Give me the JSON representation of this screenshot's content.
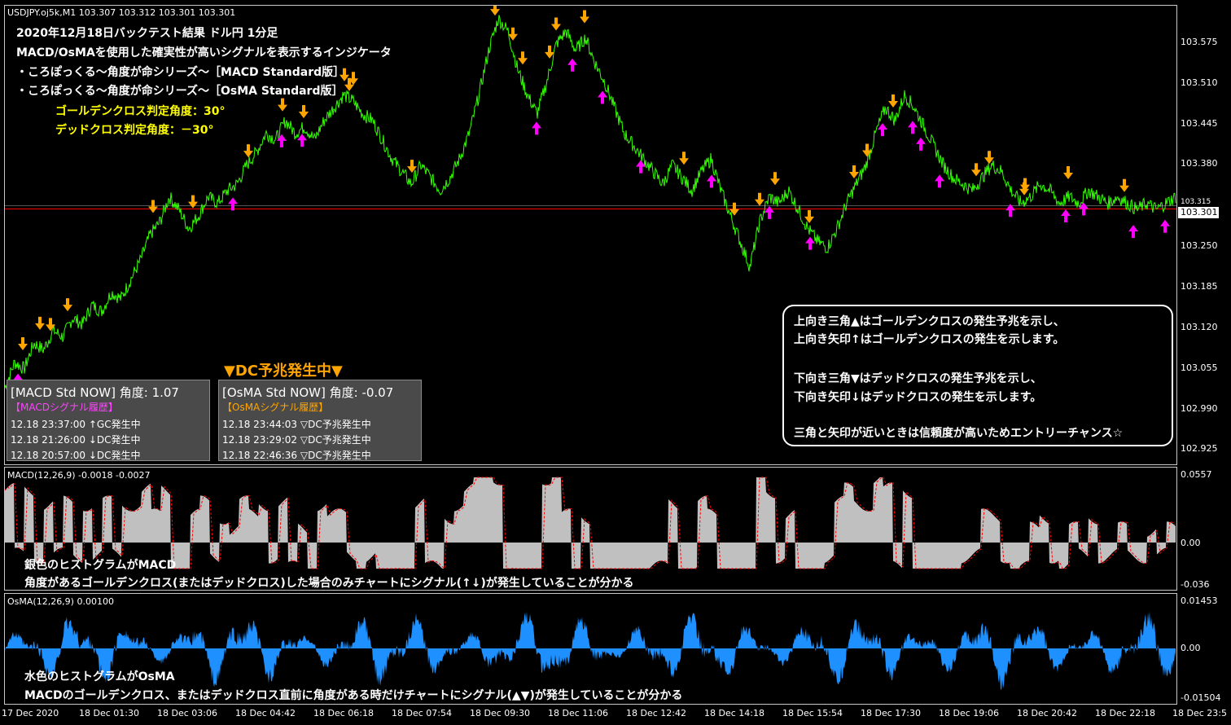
{
  "header": {
    "symbol_line": "USDJPY.oj5k,M1  103.307 103.312 103.301 103.301",
    "lines": [
      "2020年12月18日バックテスト結果 ドル円 1分足",
      "MACD/OsMAを使用した確実性が高いシグナルを表示するインジケータ",
      "・ころぽっくる～角度が命シリーズ～［MACD Standard版］",
      "・ころぽっくる～角度が命シリーズ～［OsMA Standard版］"
    ],
    "gc_angle": "ゴールデンクロス判定角度：30°",
    "dc_angle": "デッドクロス判定角度：－30°"
  },
  "price_axis": {
    "labels": [
      "103.575",
      "103.510",
      "103.445",
      "103.380",
      "103.315",
      "103.301",
      "103.250",
      "103.185",
      "103.120",
      "103.055",
      "102.990",
      "102.925"
    ]
  },
  "macd": {
    "title": "MACD(12,26,9) -0.0018 -0.0027",
    "axis": [
      "0.0557",
      "0.00",
      "-0.036"
    ],
    "note1": "銀色のヒストグラムがMACD",
    "note2": "角度があるゴールデンクロス(またはデッドクロス)した場合のみチャートにシグナル(↑↓)が発生していることが分かる"
  },
  "osma": {
    "title": "OsMA(12,26,9) 0.00100",
    "axis": [
      "0.01453",
      "0.00",
      "-0.01504"
    ],
    "note1": "水色のヒストグラムがOsMA",
    "note2": "MACDのゴールデンクロス、またはデッドクロス直前に角度がある時だけチャートにシグナル(▲▼)が発生していることが分かる"
  },
  "time_axis": [
    "17 Dec 2020",
    "18 Dec 01:30",
    "18 Dec 03:06",
    "18 Dec 04:42",
    "18 Dec 06:18",
    "18 Dec 07:54",
    "18 Dec 09:30",
    "18 Dec 11:06",
    "18 Dec 12:42",
    "18 Dec 14:18",
    "18 Dec 15:54",
    "18 Dec 17:30",
    "18 Dec 19:06",
    "18 Dec 20:42",
    "18 Dec 22:18",
    "18 Dec 23:5"
  ],
  "dc_banner": "▼DC予兆発生中▼",
  "macd_panel": {
    "header": "[MACD Std NOW] 角度: 1.07",
    "subtitle": "【MACDシグナル履歴】",
    "rows": [
      "12.18 23:37:00 ↑GC発生中",
      "12.18 21:26:00 ↓DC発生中",
      "12.18 20:57:00 ↓DC発生中"
    ]
  },
  "osma_panel": {
    "header": "[OsMA Std NOW] 角度: -0.07",
    "subtitle": "【OsMAシグナル履歴】",
    "rows": [
      "12.18 23:44:03 ▽DC予兆発生中",
      "12.18 23:29:02 ▽DC予兆発生中",
      "12.18 22:46:36 ▽DC予兆発生中"
    ]
  },
  "legend": {
    "lines": [
      "上向き三角▲はゴールデンクロスの発生予兆を示し、",
      "上向き矢印↑はゴールデンクロスの発生を示します。",
      "下向き三角▼はデッドクロスの発生予兆を示し、",
      "下向き矢印↓はデッドクロスの発生を示します。",
      "三角と矢印が近いときは信頼度が高いためエントリーチャンス☆"
    ]
  },
  "colors": {
    "price_line": "#33ff00",
    "up_arrow": "#ff00ff",
    "down_arrow": "#ffa500",
    "macd_hist": "#c0c0c0",
    "macd_signal": "#ff0000",
    "osma_hist": "#1e90ff",
    "bid_line": "#ff0000",
    "panel_subtitle_macd": "#ff44ff",
    "panel_subtitle_osma": "#ffa500",
    "banner": "#ffa500"
  },
  "price_series": [
    103.02,
    103.06,
    103.05,
    103.09,
    103.08,
    103.11,
    103.1,
    103.13,
    103.12,
    103.15,
    103.14,
    103.17,
    103.16,
    103.19,
    103.22,
    103.26,
    103.28,
    103.32,
    103.3,
    103.27,
    103.29,
    103.32,
    103.31,
    103.33,
    103.34,
    103.37,
    103.39,
    103.42,
    103.41,
    103.44,
    103.42,
    103.43,
    103.41,
    103.44,
    103.46,
    103.48,
    103.47,
    103.45,
    103.44,
    103.41,
    103.38,
    103.36,
    103.34,
    103.37,
    103.35,
    103.33,
    103.35,
    103.38,
    103.42,
    103.48,
    103.55,
    103.6,
    103.58,
    103.52,
    103.48,
    103.45,
    103.5,
    103.56,
    103.58,
    103.55,
    103.57,
    103.53,
    103.5,
    103.46,
    103.42,
    103.4,
    103.38,
    103.36,
    103.34,
    103.37,
    103.35,
    103.33,
    103.36,
    103.38,
    103.33,
    103.29,
    103.25,
    103.21,
    103.28,
    103.32,
    103.31,
    103.33,
    103.3,
    103.27,
    103.25,
    103.24,
    103.27,
    103.31,
    103.34,
    103.37,
    103.42,
    103.46,
    103.44,
    103.48,
    103.46,
    103.43,
    103.4,
    103.37,
    103.35,
    103.34,
    103.33,
    103.35,
    103.37,
    103.36,
    103.33,
    103.31,
    103.32,
    103.34,
    103.33,
    103.31,
    103.32,
    103.31,
    103.33,
    103.32,
    103.31,
    103.32,
    103.31,
    103.3,
    103.31,
    103.3,
    103.31,
    103.32
  ]
}
